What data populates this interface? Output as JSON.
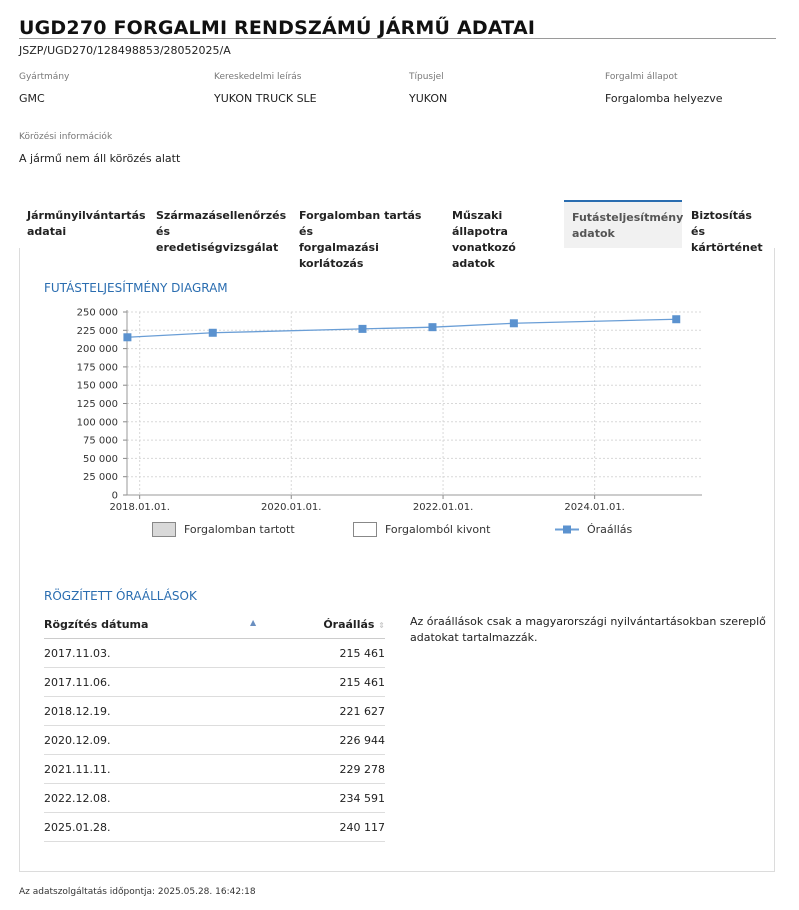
{
  "header": {
    "title": "UGD270 FORGALMI RENDSZÁMÚ JÁRMŰ ADATAI",
    "doc_id": "JSZP/UGD270/128498853/28052025/A"
  },
  "fields": [
    {
      "label": "Gyártmány",
      "value": "GMC"
    },
    {
      "label": "Kereskedelmi leírás",
      "value": "YUKON TRUCK SLE"
    },
    {
      "label": "Típusjel",
      "value": "YUKON"
    },
    {
      "label": "Forgalmi állapot",
      "value": "Forgalomba helyezve"
    }
  ],
  "pursuit": {
    "label": "Körözési információk",
    "value": "A jármű nem áll körözés alatt"
  },
  "tabs": [
    {
      "line1": "Járműnyilvántartás",
      "line2": "adatai"
    },
    {
      "line1": "Származásellenőrzés",
      "line2": "és eredetiségvizsgálat"
    },
    {
      "line1": "Forgalomban tartás és",
      "line2": "forgalmazási korlátozás"
    },
    {
      "line1": "Műszaki állapotra",
      "line2": "vonatkozó adatok"
    },
    {
      "line1": "Futásteljesítmény",
      "line2": "adatok"
    },
    {
      "line1": "Biztosítás és",
      "line2": "kártörténet"
    }
  ],
  "active_tab": 4,
  "chart_title": "FUTÁSTELJESÍTMÉNY DIAGRAM",
  "chart_data": {
    "type": "line",
    "title": "FUTÁSTELJESÍTMÉNY DIAGRAM",
    "xlabel": "",
    "ylabel": "",
    "ylim": [
      0,
      250000
    ],
    "y_ticks": [
      0,
      25000,
      50000,
      75000,
      100000,
      125000,
      150000,
      175000,
      200000,
      225000,
      250000
    ],
    "y_tick_labels": [
      "0",
      "25 000",
      "50 000",
      "75 000",
      "100 000",
      "125 000",
      "150 000",
      "175 000",
      "200 000",
      "225 000",
      "250 000"
    ],
    "xlim": [
      "2017.11.01.",
      "2025.06.01."
    ],
    "x_ticks": [
      "2018.01.01.",
      "2020.01.01.",
      "2022.01.01.",
      "2024.01.01."
    ],
    "grid": true,
    "line_color": "#6a9ed6",
    "marker_color": "#5b92cf",
    "series": [
      {
        "name": "Óraállás",
        "x": [
          "2017.11.03.",
          "2018.12.19.",
          "2020.12.09.",
          "2021.11.11.",
          "2022.12.08.",
          "2025.01.28."
        ],
        "y": [
          215461,
          221627,
          226944,
          229278,
          234591,
          240117
        ]
      }
    ]
  },
  "legend": [
    {
      "label": "Forgalomban tartott",
      "color": "#d9d9d9"
    },
    {
      "label": "Forgalomból kivont",
      "color": "#ffffff"
    },
    {
      "label": "Óraállás",
      "color": "#5b92cf"
    }
  ],
  "table": {
    "title": "RÖGZÍTETT ÓRAÁLLÁSOK",
    "headers": [
      "Rögzítés dátuma",
      "Óraállás"
    ],
    "rows": [
      [
        "2017.11.03.",
        "215 461"
      ],
      [
        "2017.11.06.",
        "215 461"
      ],
      [
        "2018.12.19.",
        "221 627"
      ],
      [
        "2020.12.09.",
        "226 944"
      ],
      [
        "2021.11.11.",
        "229 278"
      ],
      [
        "2022.12.08.",
        "234 591"
      ],
      [
        "2025.01.28.",
        "240 117"
      ]
    ]
  },
  "note": "Az óraállások csak a magyarországi nyilvántartásokban szereplő adatokat tartalmazzák.",
  "footer": "Az adatszolgáltatás időpontja: 2025.05.28. 16:42:18"
}
